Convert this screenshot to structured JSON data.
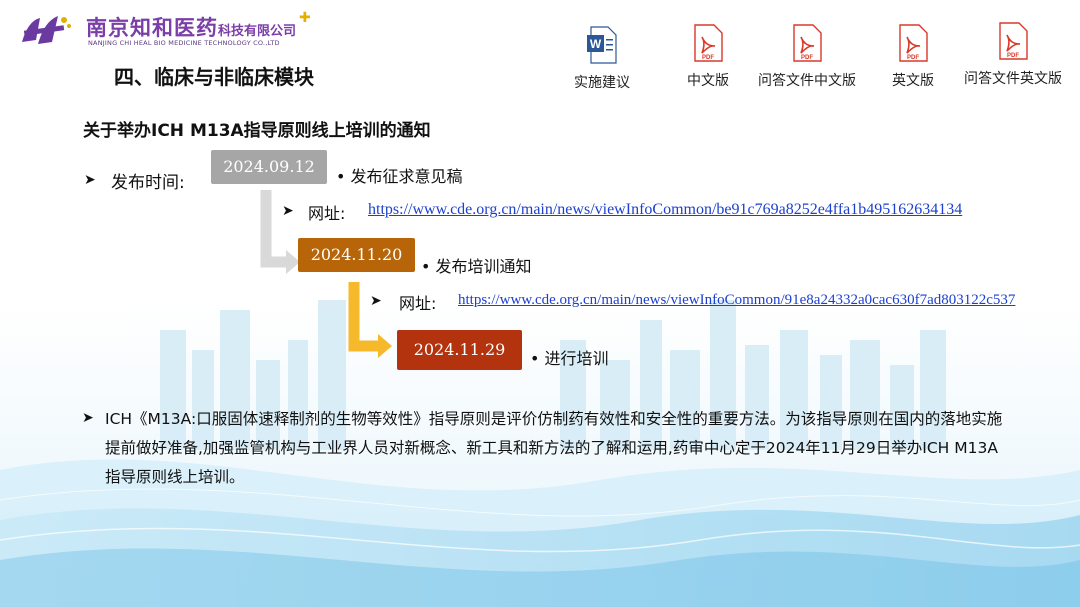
{
  "logo": {
    "name_cn": "南京知和医药",
    "name_cn_small": "科技有限公司",
    "name_en": "NANJING CHI HEAL BIO MEDICINE TECHNOLOGY CO.,LTD"
  },
  "section_title": "四、临床与非临床模块",
  "notice_title": "关于举办ICH M13A指导原则线上培训的通知",
  "files": [
    {
      "label": "实施建议",
      "icon": "word-file-icon",
      "badge": ""
    },
    {
      "label": "中文版",
      "icon": "pdf-file-icon",
      "badge": "PDF"
    },
    {
      "label": "问答文件中文版",
      "icon": "pdf-file-icon",
      "badge": "PDF"
    },
    {
      "label": "英文版",
      "icon": "pdf-file-icon",
      "badge": "PDF"
    },
    {
      "label": "问答文件英文版",
      "icon": "pdf-file-icon",
      "badge": "PDF"
    }
  ],
  "publish_label": "发布时间:",
  "timeline": [
    {
      "date": "2024.09.12",
      "event": "发布征求意见稿",
      "url_label": "网址:",
      "url": "https://www.cde.org.cn/main/news/viewInfoCommon/be91c769a8252e4ffa1b495162634134",
      "color": "#a6a6a6"
    },
    {
      "date": "2024.11.20",
      "event": "发布培训通知",
      "url_label": "网址:",
      "url": "https://www.cde.org.cn/main/news/viewInfoCommon/91e8a24332a0cac630f7ad803122c537",
      "color": "#b8650a"
    },
    {
      "date": "2024.11.29",
      "event": "进行培训",
      "color": "#b2330d"
    }
  ],
  "paragraph": "ICH《M13A:口服固体速释制剂的生物等效性》指导原则是评价仿制药有效性和安全性的重要方法。为该指导原则在国内的落地实施提前做好准备,加强监管机构与工业界人员对新概念、新工具和新方法的了解和运用,药审中心定于2024年11月29日举办ICH M13A指导原则线上培训。"
}
